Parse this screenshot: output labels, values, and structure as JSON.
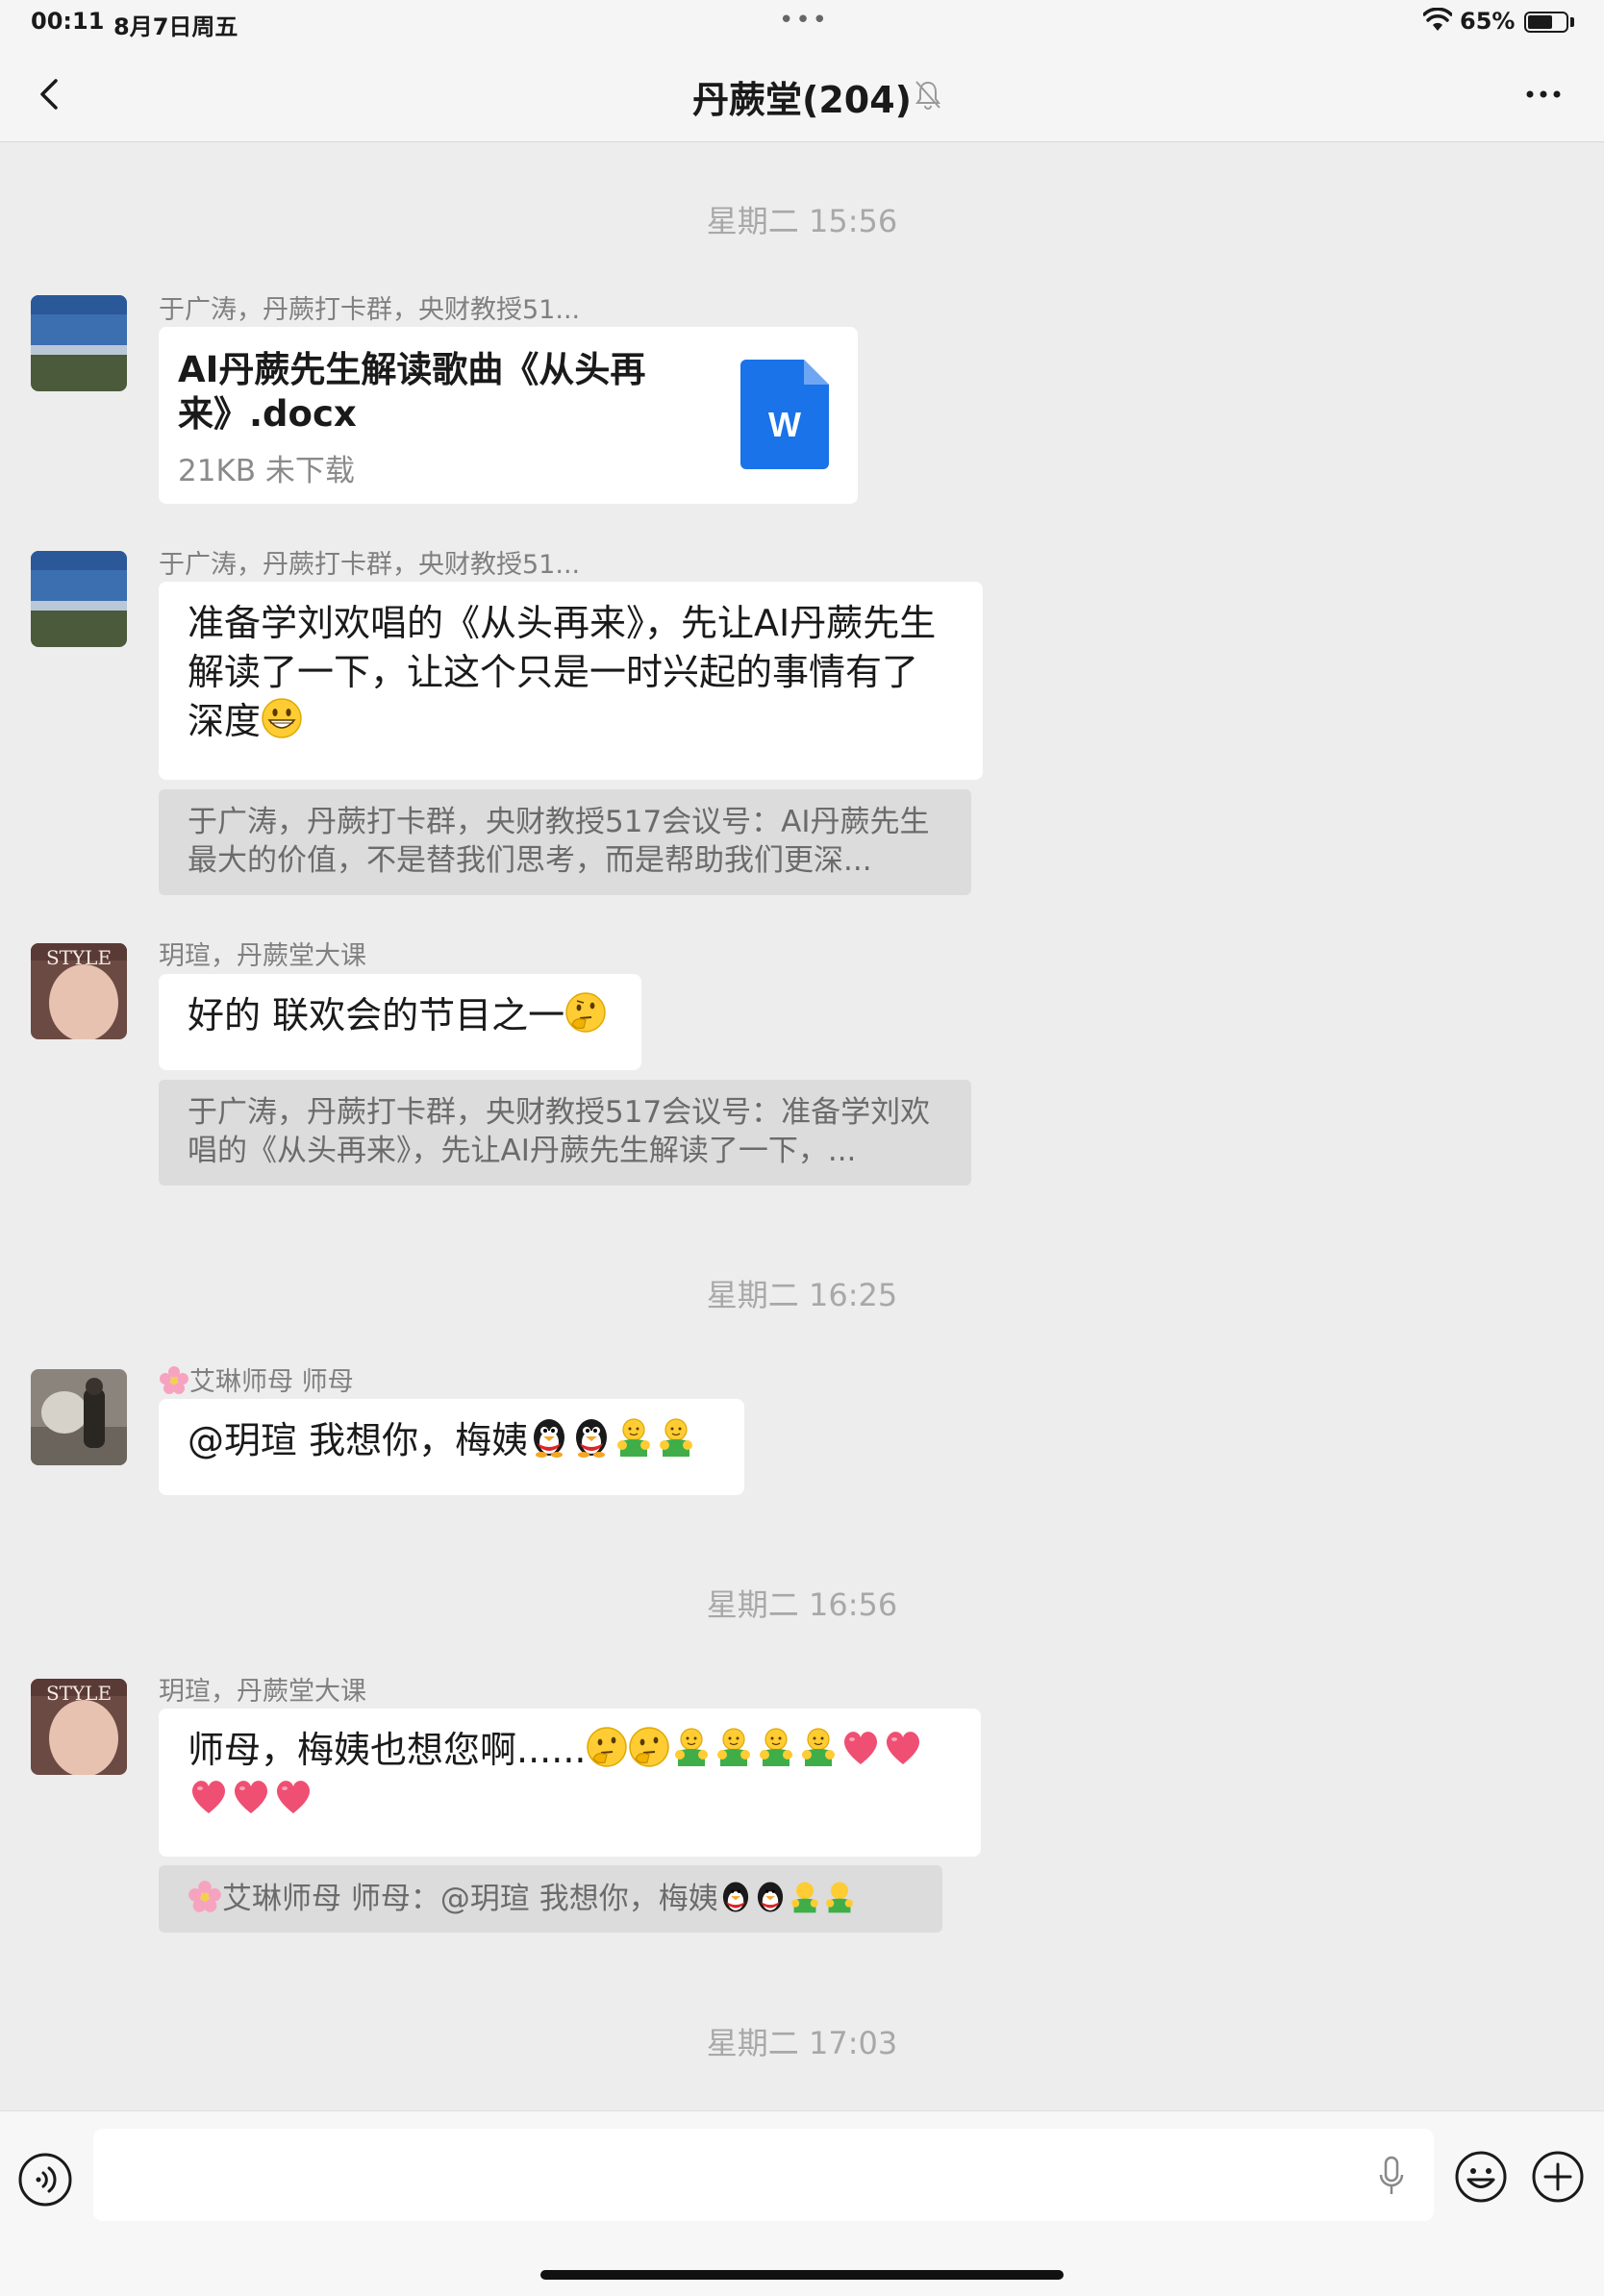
{
  "status_bar": {
    "time": "00:11",
    "date": "8月7日周五",
    "battery_text": "65%",
    "battery_level": 0.65
  },
  "header": {
    "title": "丹蕨堂(204)",
    "back_icon": "chevron-left-icon",
    "mute_icon": "bell-slash-icon",
    "more_icon": "ellipsis-icon"
  },
  "messages": {
    "ts1": "星期二 15:56",
    "m1": {
      "sender": "于广涛，丹蕨打卡群，央财教授51...",
      "file_name": "AI丹蕨先生解读歌曲《从头再来》.docx",
      "file_meta": "21KB  未下载",
      "file_badge": "W"
    },
    "m2": {
      "sender": "于广涛，丹蕨打卡群，央财教授51...",
      "text": "准备学刘欢唱的《从头再来》，先让AI丹蕨先生解读了一下，让这个只是一时兴起的事情有了深度",
      "quote": "于广涛，丹蕨打卡群，央财教授517会议号：AI丹蕨先生最大的价值，不是替我们思考，而是帮助我们更深..."
    },
    "m3": {
      "sender": "玥瑄，丹蕨堂大课",
      "text": "好的 联欢会的节目之一",
      "quote": "于广涛，丹蕨打卡群，央财教授517会议号：准备学刘欢唱的《从头再来》，先让AI丹蕨先生解读了一下，..."
    },
    "ts2": "星期二 16:25",
    "m4": {
      "sender": "艾琳师母  师母",
      "text": "@玥瑄 我想你，梅姨"
    },
    "ts3": "星期二 16:56",
    "m5": {
      "sender": "玥瑄，丹蕨堂大课",
      "text": "师母，梅姨也想您啊......",
      "quote": "艾琳师母  师母：@玥瑄 我想你，梅姨"
    },
    "ts4": "星期二 17:03"
  },
  "input": {
    "value": "",
    "voice_icon": "voice-input-icon",
    "mic_icon": "microphone-icon",
    "emoji_icon": "smiley-icon",
    "plus_icon": "plus-circle-icon"
  }
}
